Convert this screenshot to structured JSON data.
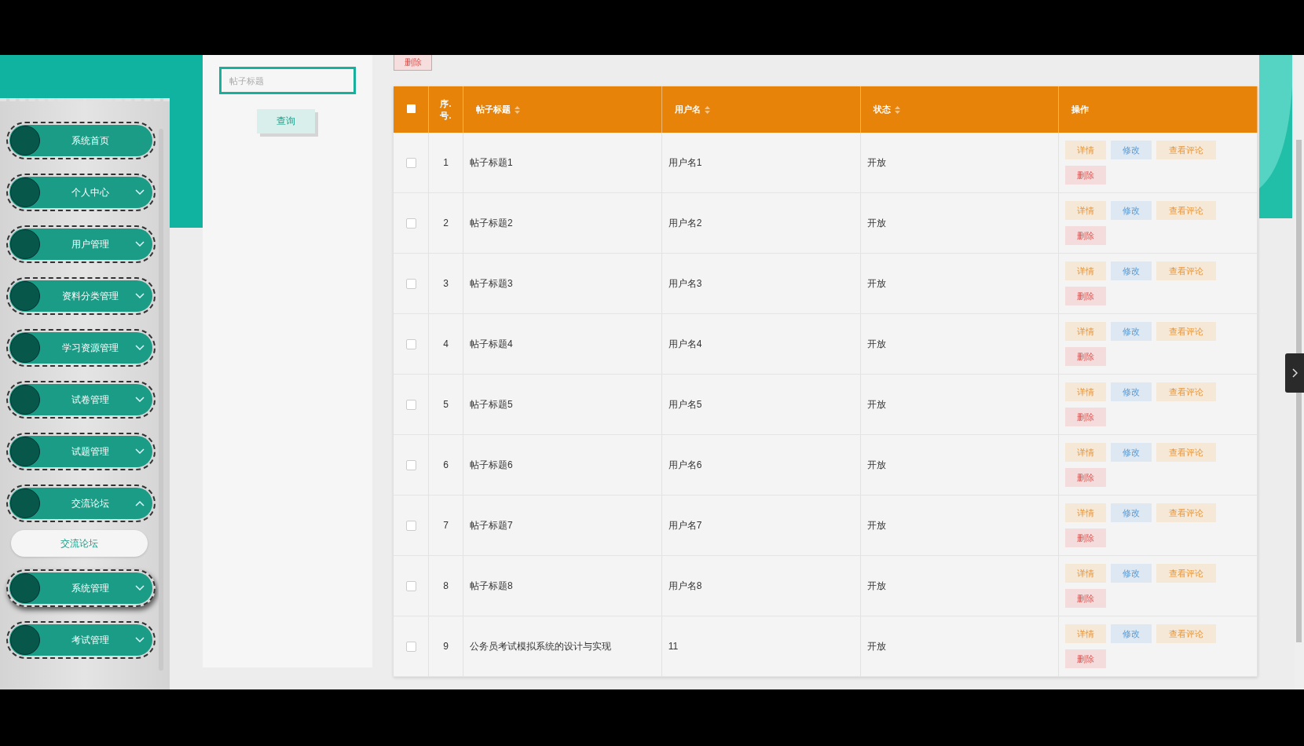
{
  "sidebar": {
    "items": [
      {
        "label": "系统首页",
        "kind": "link",
        "hovered": false
      },
      {
        "label": "个人中心",
        "kind": "group",
        "expanded": false,
        "hovered": false
      },
      {
        "label": "用户管理",
        "kind": "group",
        "expanded": false,
        "hovered": false
      },
      {
        "label": "资料分类管理",
        "kind": "group",
        "expanded": false,
        "hovered": false
      },
      {
        "label": "学习资源管理",
        "kind": "group",
        "expanded": false,
        "hovered": false
      },
      {
        "label": "试卷管理",
        "kind": "group",
        "expanded": false,
        "hovered": false
      },
      {
        "label": "试题管理",
        "kind": "group",
        "expanded": false,
        "hovered": false
      },
      {
        "label": "交流论坛",
        "kind": "group",
        "expanded": true,
        "hovered": false,
        "children": [
          {
            "label": "交流论坛"
          }
        ]
      },
      {
        "label": "系统管理",
        "kind": "group",
        "expanded": false,
        "hovered": true
      },
      {
        "label": "考试管理",
        "kind": "group",
        "expanded": false,
        "hovered": false
      }
    ]
  },
  "search": {
    "field": {
      "placeholder": "帖子标题"
    },
    "button": "查询"
  },
  "toolbar": {
    "delete_button": "删除"
  },
  "table": {
    "select_all_checked": false,
    "columns": [
      {
        "label": "序.号.",
        "sortable": false
      },
      {
        "label": "帖子标题",
        "sortable": true
      },
      {
        "label": "用户名",
        "sortable": true
      },
      {
        "label": "状态",
        "sortable": true
      },
      {
        "label": "操作",
        "sortable": false
      }
    ],
    "rows": [
      {
        "checked": false,
        "index": "1",
        "title": "帖子标题1",
        "username": "用户名1",
        "status": "开放",
        "actions": [
          {
            "kind": "detail",
            "label": "详情"
          },
          {
            "kind": "edit",
            "label": "修改"
          },
          {
            "kind": "comments",
            "label": "查看评论"
          },
          {
            "kind": "delete",
            "label": "删除"
          }
        ]
      },
      {
        "checked": false,
        "index": "2",
        "title": "帖子标题2",
        "username": "用户名2",
        "status": "开放",
        "actions": [
          {
            "kind": "detail",
            "label": "详情"
          },
          {
            "kind": "edit",
            "label": "修改"
          },
          {
            "kind": "comments",
            "label": "查看评论"
          },
          {
            "kind": "delete",
            "label": "删除"
          }
        ]
      },
      {
        "checked": false,
        "index": "3",
        "title": "帖子标题3",
        "username": "用户名3",
        "status": "开放",
        "actions": [
          {
            "kind": "detail",
            "label": "详情"
          },
          {
            "kind": "edit",
            "label": "修改"
          },
          {
            "kind": "comments",
            "label": "查看评论"
          },
          {
            "kind": "delete",
            "label": "删除"
          }
        ]
      },
      {
        "checked": false,
        "index": "4",
        "title": "帖子标题4",
        "username": "用户名4",
        "status": "开放",
        "actions": [
          {
            "kind": "detail",
            "label": "详情"
          },
          {
            "kind": "edit",
            "label": "修改"
          },
          {
            "kind": "comments",
            "label": "查看评论"
          },
          {
            "kind": "delete",
            "label": "删除"
          }
        ]
      },
      {
        "checked": false,
        "index": "5",
        "title": "帖子标题5",
        "username": "用户名5",
        "status": "开放",
        "actions": [
          {
            "kind": "detail",
            "label": "详情"
          },
          {
            "kind": "edit",
            "label": "修改"
          },
          {
            "kind": "comments",
            "label": "查看评论"
          },
          {
            "kind": "delete",
            "label": "删除"
          }
        ]
      },
      {
        "checked": false,
        "index": "6",
        "title": "帖子标题6",
        "username": "用户名6",
        "status": "开放",
        "actions": [
          {
            "kind": "detail",
            "label": "详情"
          },
          {
            "kind": "edit",
            "label": "修改"
          },
          {
            "kind": "comments",
            "label": "查看评论"
          },
          {
            "kind": "delete",
            "label": "删除"
          }
        ]
      },
      {
        "checked": false,
        "index": "7",
        "title": "帖子标题7",
        "username": "用户名7",
        "status": "开放",
        "actions": [
          {
            "kind": "detail",
            "label": "详情"
          },
          {
            "kind": "edit",
            "label": "修改"
          },
          {
            "kind": "comments",
            "label": "查看评论"
          },
          {
            "kind": "delete",
            "label": "删除"
          }
        ]
      },
      {
        "checked": false,
        "index": "8",
        "title": "帖子标题8",
        "username": "用户名8",
        "status": "开放",
        "actions": [
          {
            "kind": "detail",
            "label": "详情"
          },
          {
            "kind": "edit",
            "label": "修改"
          },
          {
            "kind": "comments",
            "label": "查看评论"
          },
          {
            "kind": "delete",
            "label": "删除"
          }
        ]
      },
      {
        "checked": false,
        "index": "9",
        "title": "公务员考试模拟系统的设计与实现",
        "username": "11",
        "status": "开放",
        "actions": [
          {
            "kind": "detail",
            "label": "详情"
          },
          {
            "kind": "edit",
            "label": "修改"
          },
          {
            "kind": "comments",
            "label": "查看评论"
          },
          {
            "kind": "delete",
            "label": "删除"
          }
        ]
      }
    ]
  }
}
